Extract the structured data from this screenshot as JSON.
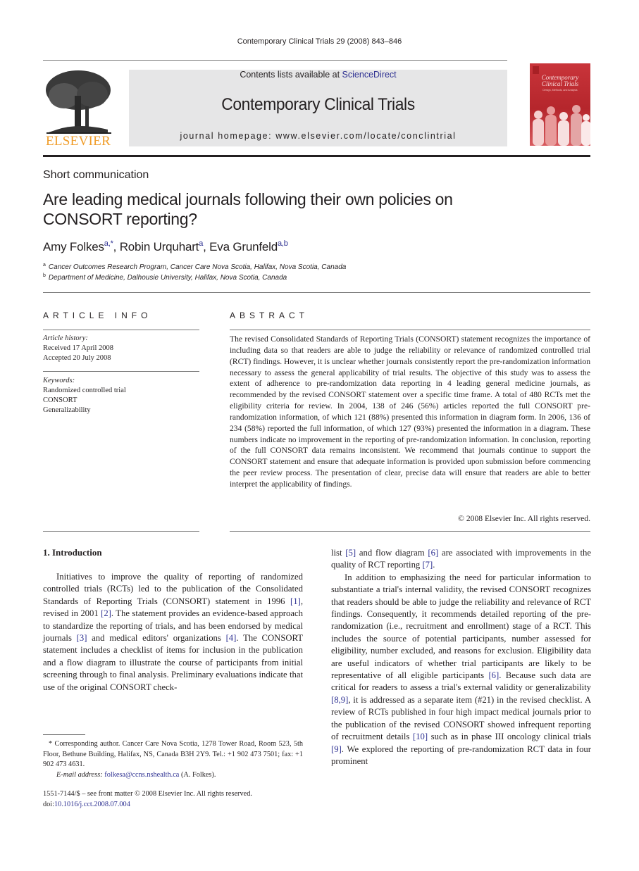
{
  "running_head": "Contemporary Clinical Trials 29 (2008) 843–846",
  "publisher": {
    "name": "ELSEVIER",
    "logo_color": "#f09d2a"
  },
  "banner": {
    "contents_prefix": "Contents lists available at ",
    "contents_link": "ScienceDirect",
    "journal_title": "Contemporary Clinical Trials",
    "homepage": "journal homepage: www.elsevier.com/locate/conclintrial",
    "background": "#e6e6e7"
  },
  "cover": {
    "title_line1": "Contemporary",
    "title_line2": "Clinical Trials",
    "subtitle": "Design, Methods, and Analysis",
    "color": "#c9343a"
  },
  "article": {
    "section_type": "Short communication",
    "title_line1": "Are leading medical journals following their own policies on",
    "title_line2": "CONSORT reporting?",
    "authors": [
      {
        "name": "Amy Folkes",
        "sup": "a,*",
        "sep": ", "
      },
      {
        "name": "Robin Urquhart",
        "sup": "a",
        "sep": ", "
      },
      {
        "name": "Eva Grunfeld",
        "sup": "a,b",
        "sep": ""
      }
    ],
    "affiliations": [
      {
        "mark": "a",
        "text": "Cancer Outcomes Research Program, Cancer Care Nova Scotia, Halifax, Nova Scotia, Canada"
      },
      {
        "mark": "b",
        "text": "Department of Medicine, Dalhousie University, Halifax, Nova Scotia, Canada"
      }
    ]
  },
  "article_info": {
    "heading": "ARTICLE INFO",
    "history_label": "Article history:",
    "received": "Received 17 April 2008",
    "accepted": "Accepted 20 July 2008",
    "keywords_label": "Keywords:",
    "keywords": [
      "Randomized controlled trial",
      "CONSORT",
      "Generalizability"
    ]
  },
  "abstract": {
    "heading": "ABSTRACT",
    "text": "The revised Consolidated Standards of Reporting Trials (CONSORT) statement recognizes the importance of including data so that readers are able to judge the reliability or relevance of randomized controlled trial (RCT) findings. However, it is unclear whether journals consistently report the pre-randomization information necessary to assess the general applicability of trial results. The objective of this study was to assess the extent of adherence to pre-randomization data reporting in 4 leading general medicine journals, as recommended by the revised CONSORT statement over a specific time frame. A total of 480 RCTs met the eligibility criteria for review. In 2004, 138 of 246 (56%) articles reported the full CONSORT pre-randomization information, of which 121 (88%) presented this information in diagram form. In 2006, 136 of 234 (58%) reported the full information, of which 127 (93%) presented the information in a diagram. These numbers indicate no improvement in the reporting of pre-randomization information. In conclusion, reporting of the full CONSORT data remains inconsistent. We recommend that journals continue to support the CONSORT statement and ensure that adequate information is provided upon submission before commencing the peer review process. The presentation of clear, precise data will ensure that readers are able to better interpret the applicability of findings.",
    "copyright": "© 2008 Elsevier Inc. All rights reserved."
  },
  "introduction": {
    "heading": "1. Introduction",
    "left_col": [
      {
        "t": "Initiatives to improve the quality of reporting of randomized controlled trials (RCTs) led to the publication of the Consolidated Standards of Reporting Trials (CONSORT) statement in 1996 "
      },
      {
        "ref": "[1]"
      },
      {
        "t": ", revised in 2001 "
      },
      {
        "ref": "[2]"
      },
      {
        "t": ". The statement provides an evidence-based approach to standardize the reporting of trials, and has been endorsed by medical journals "
      },
      {
        "ref": "[3]"
      },
      {
        "t": " and medical editors' organizations "
      },
      {
        "ref": "[4]"
      },
      {
        "t": ". The CONSORT statement includes a checklist of items for inclusion in the publication and a flow diagram to illustrate the course of participants from initial screening through to final analysis. Preliminary evaluations indicate that use of the original CONSORT check-"
      }
    ],
    "right_col_p1": [
      {
        "t": "list "
      },
      {
        "ref": "[5]"
      },
      {
        "t": " and flow diagram "
      },
      {
        "ref": "[6]"
      },
      {
        "t": " are associated with improvements in the quality of RCT reporting "
      },
      {
        "ref": "[7]"
      },
      {
        "t": "."
      }
    ],
    "right_col_p2": [
      {
        "t": "In addition to emphasizing the need for particular information to substantiate a trial's internal validity, the revised CONSORT recognizes that readers should be able to judge the reliability and relevance of RCT findings. Consequently, it recommends detailed reporting of the pre-randomization (i.e., recruitment and enrollment) stage of a RCT. This includes the source of potential participants, number assessed for eligibility, number excluded, and reasons for exclusion. Eligibility data are useful indicators of whether trial participants are likely to be representative of all eligible participants "
      },
      {
        "ref": "[6]"
      },
      {
        "t": ". Because such data are critical for readers to assess a trial's external validity or generalizability "
      },
      {
        "ref": "[8,9]"
      },
      {
        "t": ", it is addressed as a separate item (#21) in the revised checklist. A review of RCTs published in four high impact medical journals prior to the publication of the revised CONSORT showed infrequent reporting of recruitment details "
      },
      {
        "ref": "[10]"
      },
      {
        "t": " such as in phase III oncology clinical trials "
      },
      {
        "ref": "[9]"
      },
      {
        "t": ". We explored the reporting of pre-randomization RCT data in four prominent"
      }
    ]
  },
  "footnotes": {
    "corresponding": "* Corresponding author. Cancer Care Nova Scotia, 1278 Tower Road, Room 523, 5th Floor, Bethune Building, Halifax, NS, Canada B3H 2Y9. Tel.: +1 902 473 7501; fax: +1 902 473 4631.",
    "email_label": "E-mail address:",
    "email": "folkesa@ccns.nshealth.ca",
    "email_suffix": " (A. Folkes).",
    "issn_line": "1551-7144/$ – see front matter © 2008 Elsevier Inc. All rights reserved.",
    "doi_label": "doi:",
    "doi": "10.1016/j.cct.2008.07.004"
  },
  "colors": {
    "link": "#2e3192",
    "text": "#231f20"
  }
}
